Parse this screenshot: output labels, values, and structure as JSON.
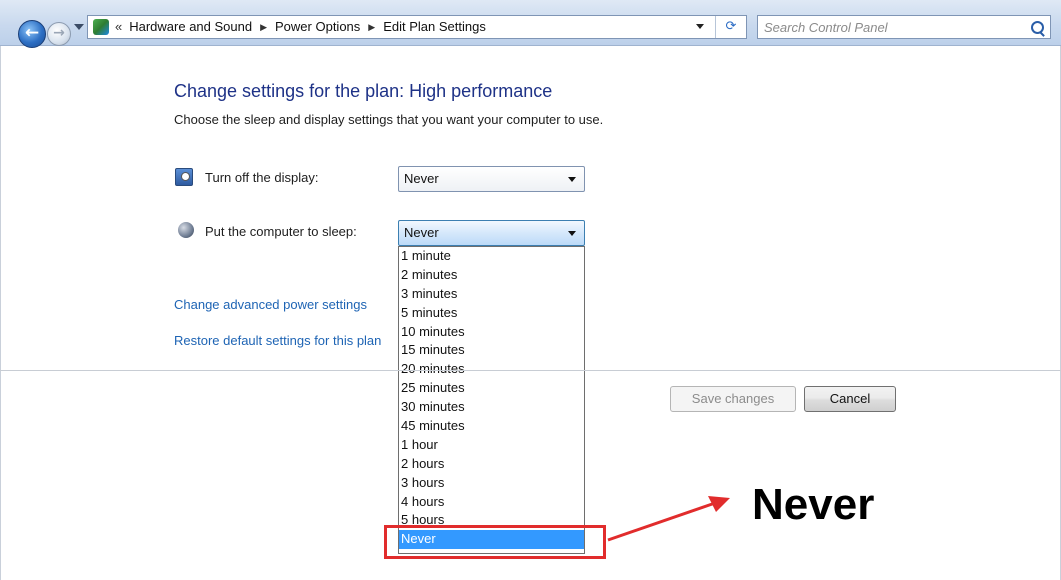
{
  "address_bar": {
    "breadcrumbs": [
      "Hardware and Sound",
      "Power Options",
      "Edit Plan Settings"
    ],
    "overflow_chevron": "«",
    "search_placeholder": "Search Control Panel"
  },
  "icons": {
    "back": "back-arrow-icon",
    "forward": "forward-arrow-icon",
    "history": "recent-pages-chevron-icon",
    "control_panel": "control-panel-icon",
    "refresh": "refresh-icon",
    "search": "search-icon",
    "display": "display-power-icon",
    "sleep": "sleep-moon-icon"
  },
  "main": {
    "title": "Change settings for the plan: High performance",
    "subtitle": "Choose the sleep and display settings that you want your computer to use.",
    "settings": [
      {
        "label": "Turn off the display:",
        "value": "Never"
      },
      {
        "label": "Put the computer to sleep:",
        "value": "Never"
      }
    ],
    "sleep_options": [
      "1 minute",
      "2 minutes",
      "3 minutes",
      "5 minutes",
      "10 minutes",
      "15 minutes",
      "20 minutes",
      "25 minutes",
      "30 minutes",
      "45 minutes",
      "1 hour",
      "2 hours",
      "3 hours",
      "4 hours",
      "5 hours",
      "Never"
    ],
    "selected_option": "Never",
    "links": {
      "advanced": "Change advanced power settings",
      "restore": "Restore default settings for this plan"
    },
    "buttons": {
      "save": "Save changes",
      "cancel": "Cancel"
    }
  },
  "annotation": {
    "text": "Never",
    "color": "#e12c2c"
  },
  "colors": {
    "title": "#1e3287",
    "link": "#1e64b4",
    "selection": "#3399ff"
  }
}
